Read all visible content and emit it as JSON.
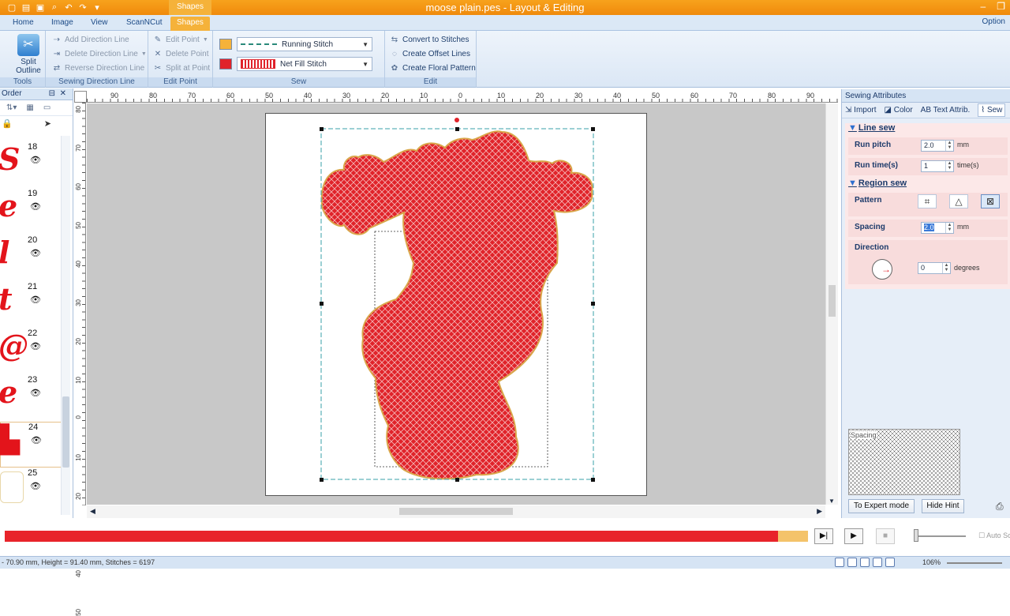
{
  "title": "moose plain.pes - Layout & Editing",
  "context_tab": "Shapes",
  "tabs": [
    "Home",
    "Image",
    "View",
    "ScanNCut",
    "Shapes"
  ],
  "option_label": "Option",
  "ribbon": {
    "tools": {
      "split_outline": "Split\nOutline",
      "label": "Tools"
    },
    "direction": {
      "add": "Add Direction Line",
      "delete": "Delete Direction Line",
      "reverse": "Reverse Direction Line",
      "label": "Sewing Direction Line"
    },
    "edit_point": {
      "edit": "Edit Point",
      "delete": "Delete Point",
      "split": "Split at Point",
      "label": "Edit Point"
    },
    "sew": {
      "line_stitch": "Running Stitch",
      "region_stitch": "Net Fill Stitch",
      "label": "Sew",
      "line_color": "#f5b23a",
      "region_color": "#e0232a"
    },
    "edit": {
      "convert": "Convert to Stitches",
      "offset": "Create Offset Lines",
      "floral": "Create Floral Pattern",
      "label": "Edit"
    }
  },
  "sew_order": {
    "header": "Order",
    "items": [
      {
        "num": "18",
        "glyph": "S"
      },
      {
        "num": "19",
        "glyph": "e"
      },
      {
        "num": "20",
        "glyph": "l"
      },
      {
        "num": "21",
        "glyph": "t"
      },
      {
        "num": "22",
        "glyph": "@"
      },
      {
        "num": "23",
        "glyph": "e"
      },
      {
        "num": "24",
        "glyph": "▙"
      },
      {
        "num": "25",
        "glyph": ""
      }
    ]
  },
  "ruler": {
    "h_labels": [
      "90",
      "80",
      "70",
      "60",
      "50",
      "40",
      "30",
      "20",
      "10",
      "0",
      "10",
      "20",
      "30",
      "40",
      "50",
      "60",
      "70",
      "80",
      "90"
    ],
    "v_labels": [
      "80",
      "70",
      "60",
      "50",
      "40",
      "30",
      "20",
      "10",
      "0",
      "10",
      "20",
      "30",
      "40",
      "50"
    ]
  },
  "attributes": {
    "header": "Sewing Attributes",
    "tabs": [
      "Import",
      "Color",
      "Text Attrib.",
      "Sew"
    ],
    "line_sew": {
      "title": "Line sew",
      "run_pitch_label": "Run pitch",
      "run_pitch": "2.0",
      "run_pitch_unit": "mm",
      "run_time_label": "Run time(s)",
      "run_time": "1",
      "run_time_unit": "time(s)"
    },
    "region_sew": {
      "title": "Region sew",
      "pattern_label": "Pattern",
      "spacing_label": "Spacing",
      "spacing": "2.0",
      "spacing_unit": "mm",
      "direction_label": "Direction",
      "direction": "0",
      "direction_unit": "degrees"
    },
    "hint_label": "Spacing",
    "expert_btn": "To Expert mode",
    "hide_hint_btn": "Hide Hint"
  },
  "progress": {
    "fill_fraction": 0.963
  },
  "playback": {
    "auto_scroll": "Auto Scroll"
  },
  "status": {
    "text": "- 70.90 mm, Height = 91.40 mm, Stitches = 6197",
    "zoom": "106%"
  }
}
